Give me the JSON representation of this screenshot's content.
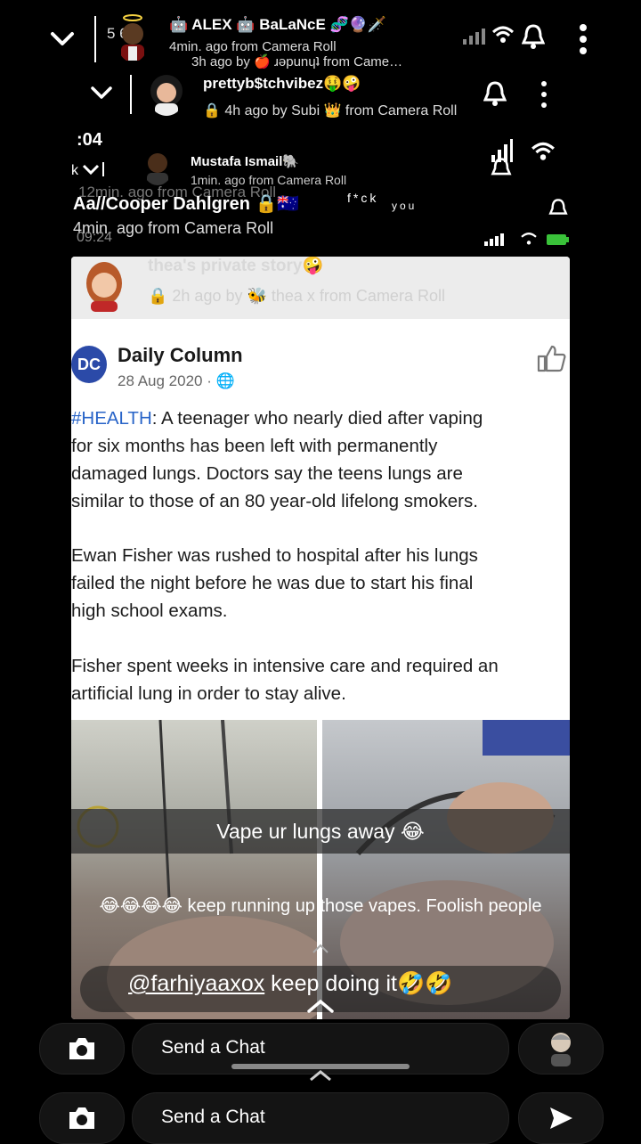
{
  "header1": {
    "name": "🤖 ALEX 🤖 BaLaNcE 🧬🔮🗡️",
    "count": "5 6",
    "sub1": "4min. ago from Camera Roll",
    "sub2": "3h ago by 🍎 ɹǝpunɥʇ from Came…"
  },
  "header2": {
    "name": "prettyb$tchvibez🤑🤪",
    "sub": "🔒 4h ago by Subi 👑 from Camera Roll"
  },
  "header3": {
    "time": ":04",
    "name": "Mustafa Ismail🐘",
    "sub": "1min. ago from Camera Roll",
    "sub_ghost": "12min. ago from Camera Roll",
    "name2": "Aa//Cooper Dahlgren 🔒🇦🇺",
    "flair": "f*ck",
    "flair2": "you",
    "sub2": "4min. ago from Camera Roll",
    "time2": "09:24"
  },
  "story": {
    "title": "thea's private story🤪",
    "sub": "🔒 2h ago by 🐝 thea x from Camera Roll"
  },
  "post": {
    "logo": "DC",
    "page_name": "Daily Column",
    "date": "28 Aug 2020 · 🌐",
    "hashtag": "#HEALTH",
    "para1_rest": ": A teenager who nearly died after vaping\nfor six months has been left with permanently\ndamaged lungs. Doctors say the teens lungs are\nsimilar to those of an 80 year-old lifelong smokers.",
    "para2": "Ewan Fisher was rushed to hospital after his lungs\nfailed the night before he was due to start his final\nhigh school exams.",
    "para3": "Fisher spent weeks in intensive care and required an\nartificial lung in order to stay alive."
  },
  "captions": {
    "c1": "Vape ur lungs away 😂",
    "c2": "😂😂😂😂 keep running up those vapes. Foolish people",
    "mention": "@farhiyaaxox",
    "c3_rest": " keep doing it🤣🤣"
  },
  "chat": {
    "label1": "Send a Chat",
    "label2": "Send a Chat"
  },
  "colors": {
    "accent_blue": "#2864c8",
    "logo_blue": "#2b4aa8"
  }
}
